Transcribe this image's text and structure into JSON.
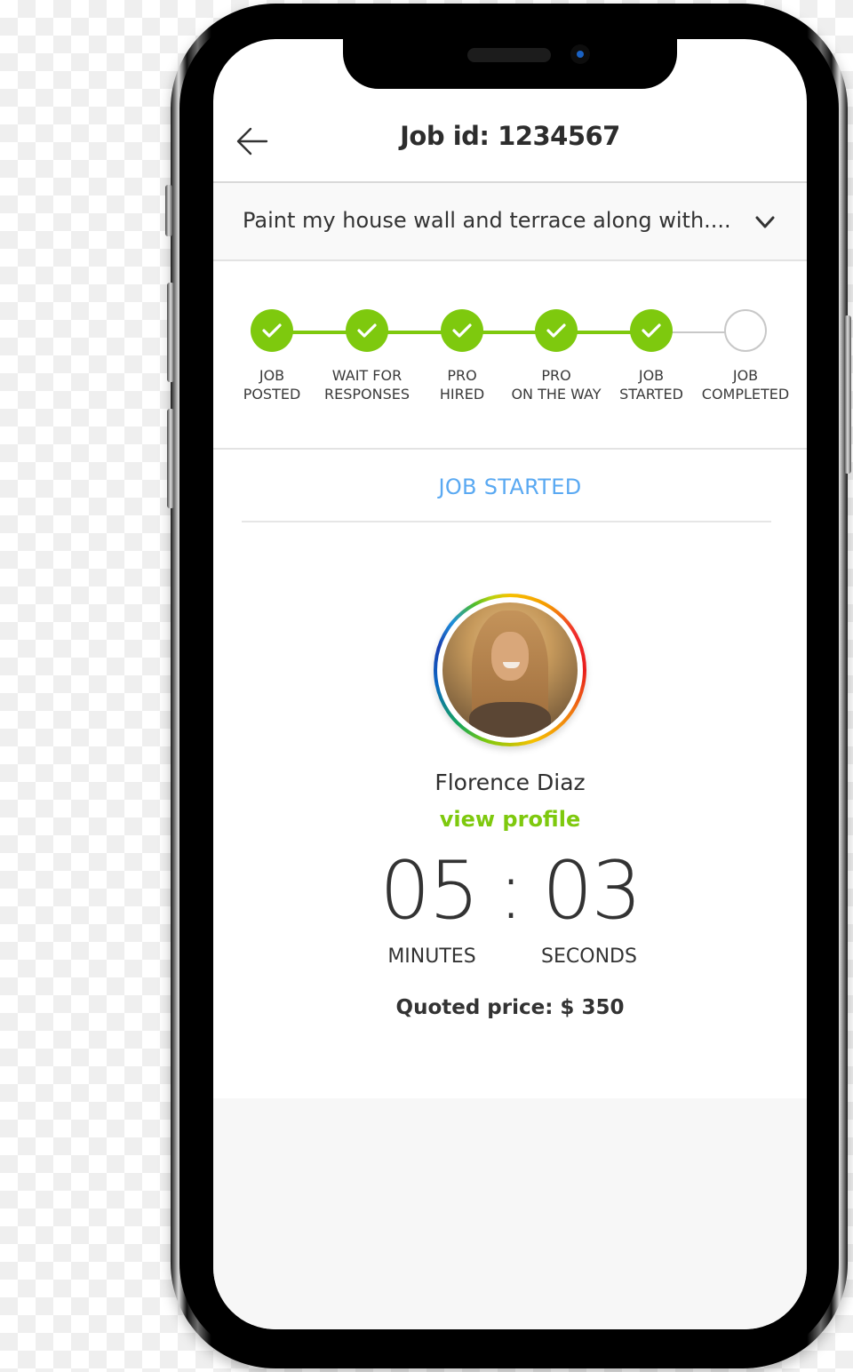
{
  "header": {
    "title": "Job id: 1234567",
    "back_icon": "arrow-left-icon"
  },
  "job": {
    "description": "Paint my house wall and terrace along with....",
    "expand_icon": "chevron-down-icon"
  },
  "progress": {
    "completed_steps": 5,
    "total_steps": 6,
    "steps": [
      {
        "line1": "JOB",
        "line2": "POSTED",
        "done": true
      },
      {
        "line1": "WAIT FOR",
        "line2": "RESPONSES",
        "done": true
      },
      {
        "line1": "PRO",
        "line2": "HIRED",
        "done": true
      },
      {
        "line1": "PRO",
        "line2": "ON THE WAY",
        "done": true
      },
      {
        "line1": "JOB",
        "line2": "STARTED",
        "done": true
      },
      {
        "line1": "JOB",
        "line2": "COMPLETED",
        "done": false
      }
    ]
  },
  "status": {
    "label": "JOB STARTED"
  },
  "pro": {
    "name": "Florence Diaz",
    "view_profile_label": "view profile"
  },
  "timer": {
    "minutes": "05",
    "separator": ":",
    "seconds": "03",
    "minutes_label": "MINUTES",
    "seconds_label": "SECONDS"
  },
  "quote": {
    "label": "Quoted price: $ 350"
  },
  "colors": {
    "accent_green": "#7ec90e",
    "status_blue": "#5aa9f2",
    "pending_gray": "#c8c8c8",
    "text_dark": "#2d2d2d"
  }
}
